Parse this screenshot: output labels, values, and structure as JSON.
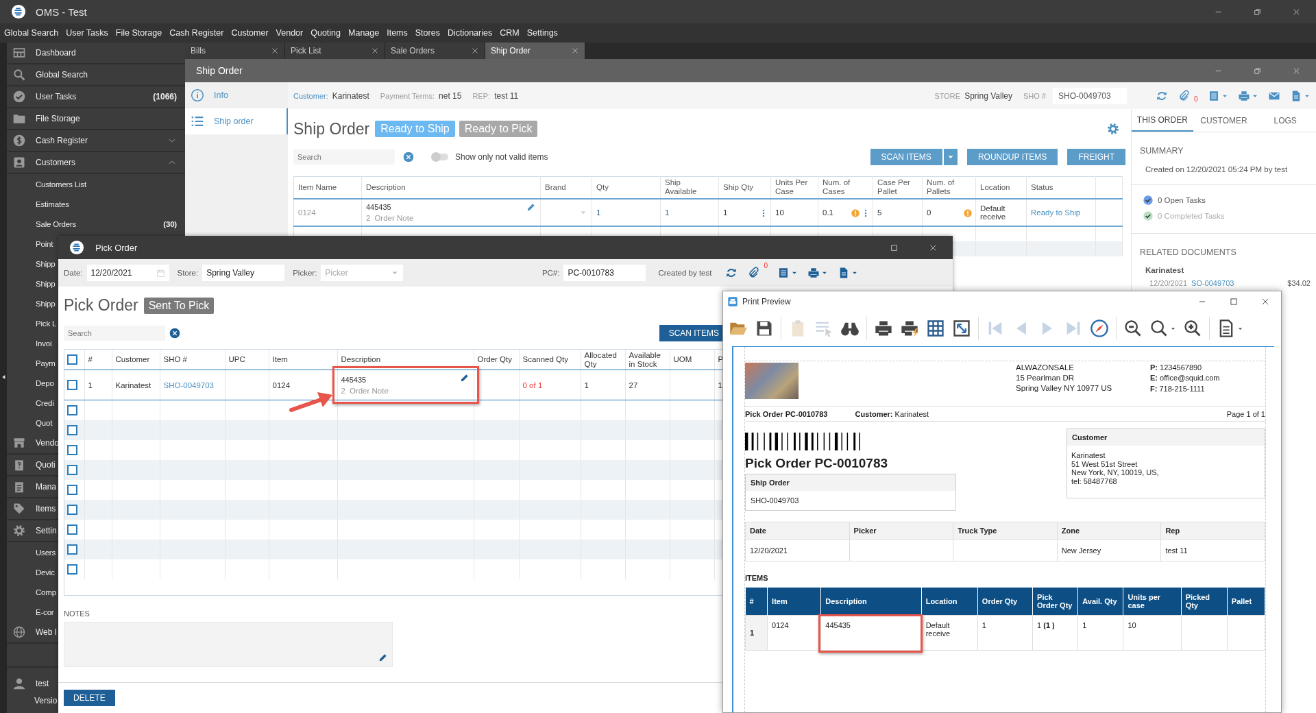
{
  "window": {
    "title": "OMS - Test"
  },
  "menu": [
    "Global Search",
    "User Tasks",
    "File Storage",
    "Cash Register",
    "Customer",
    "Vendor",
    "Quoting",
    "Manage",
    "Items",
    "Stores",
    "Dictionaries",
    "CRM",
    "Settings"
  ],
  "sidebar": {
    "items": [
      {
        "label": "Dashboard"
      },
      {
        "label": "Global Search"
      },
      {
        "label": "User Tasks",
        "count": "(1066)"
      },
      {
        "label": "File Storage"
      },
      {
        "label": "Cash Register",
        "expanded": false
      },
      {
        "label": "Customers",
        "expanded": true,
        "children": [
          {
            "label": "Customers List"
          },
          {
            "label": "Estimates"
          },
          {
            "label": "Sale Orders",
            "count": "(30)"
          },
          {
            "label": "Point"
          },
          {
            "label": "Shipp"
          },
          {
            "label": "Shipp"
          },
          {
            "label": "Shipp"
          },
          {
            "label": "Pick L"
          },
          {
            "label": "Invoi"
          },
          {
            "label": "Paym"
          },
          {
            "label": "Depo"
          },
          {
            "label": "Credi"
          },
          {
            "label": "Quot"
          }
        ]
      },
      {
        "label": "Vendo"
      },
      {
        "label": "Quoti"
      },
      {
        "label": "Mana"
      },
      {
        "label": "Items"
      },
      {
        "label": "Settin",
        "children": [
          {
            "label": "Users"
          },
          {
            "label": "Devic"
          },
          {
            "label": "Comp"
          },
          {
            "label": "E-cor"
          }
        ]
      },
      {
        "label": "Web I"
      }
    ],
    "user": "test",
    "version": "Versio"
  },
  "tabs": [
    {
      "label": "Bills",
      "selected": false
    },
    {
      "label": "Pick List",
      "selected": false
    },
    {
      "label": "Sale Orders",
      "selected": false
    },
    {
      "label": "Ship Order",
      "selected": true
    }
  ],
  "ship_order": {
    "title": "Ship Order",
    "nav": [
      {
        "label": "Info",
        "selected": false
      },
      {
        "label": "Ship order",
        "selected": true
      }
    ],
    "info": [
      {
        "label": "Customer:",
        "value": "Karinatest",
        "kind": "link"
      },
      {
        "label": "Payment Terms:",
        "value": "net 15",
        "kind": "plain"
      },
      {
        "label": "REP:",
        "value": "test 11",
        "kind": "plain"
      }
    ],
    "store_label": "STORE",
    "store": "Spring Valley",
    "sho_label": "SHO #",
    "sho": "SHO-0049703",
    "attachments": "0",
    "heading": "Ship Order",
    "statuses": [
      {
        "label": "Ready to Ship",
        "active": true
      },
      {
        "label": "Ready to Pick",
        "active": false
      }
    ],
    "search": {
      "placeholder": "Search"
    },
    "filter_toggle": {
      "label": "Show only not valid items",
      "on": false
    },
    "buttons": [
      "SCAN ITEMS",
      "ROUNDUP ITEMS",
      "FREIGHT"
    ],
    "table": {
      "columns": [
        "Item Name",
        "Description",
        "Brand",
        "Qty",
        "Ship Available",
        "Ship Qty",
        "Units Per Case",
        "Num. of Cases",
        "Case Per Pallet",
        "Num. of Pallets",
        "Location",
        "Status"
      ],
      "rows": [
        {
          "item_name": "0124",
          "description": "445435",
          "note_count": "2",
          "note": "Order Note",
          "qty": "1",
          "ship_available": "1",
          "ship_qty": "1",
          "units_per_case": "10",
          "num_cases": "0.1",
          "cases_warning": true,
          "case_per_pallet": "5",
          "num_pallets": "0",
          "pallets_warning": true,
          "location": "Default receive",
          "status": "Ready to Ship"
        }
      ]
    }
  },
  "right_panel": {
    "tabs": [
      {
        "label": "THIS ORDER",
        "selected": true
      },
      {
        "label": "CUSTOMER",
        "selected": false
      },
      {
        "label": "LOGS",
        "selected": false
      }
    ],
    "summary_title": "SUMMARY",
    "created": "Created on 12/20/2021 05:24 PM by test",
    "tasks": [
      {
        "label": "0 Open Tasks",
        "active": true
      },
      {
        "label": "0 Completed Tasks",
        "active": false
      }
    ],
    "related_title": "RELATED DOCUMENTS",
    "related": [
      {
        "customer": "Karinatest",
        "date": "12/20/2021",
        "number": "SO-0049703",
        "amount": "$34.02"
      }
    ]
  },
  "pick_order": {
    "title": "Pick Order",
    "date_label": "Date:",
    "date": "12/20/2021",
    "store_label": "Store:",
    "store": "Spring Valley",
    "picker_label": "Picker:",
    "picker_placeholder": "Picker",
    "pc_label": "PC#:",
    "pc": "PC-0010783",
    "created": "Created by test",
    "attachments": "0",
    "heading": "Pick Order",
    "status": "Sent To Pick",
    "search": {
      "placeholder": "Search"
    },
    "scan_button": "SCAN ITEMS",
    "select_all_checked": false,
    "columns": [
      "#",
      "Customer",
      "SHO #",
      "UPC",
      "Item",
      "Description",
      "Order Qty",
      "Scanned Qty",
      "Allocated Qty",
      "Available in Stock",
      "UOM",
      "P"
    ],
    "rows": [
      {
        "checked": false,
        "number": "1",
        "customer": "Karinatest",
        "sho": "SHO-0049703",
        "item": "0124",
        "description": "445435",
        "note_count": "2",
        "note": "Order Note",
        "highlighted": true,
        "scanned": "0 of 1",
        "allocated": "1",
        "available": "27",
        "column_12": "1"
      }
    ],
    "blank_rows": [
      {
        "checked": false
      },
      {
        "checked": false
      },
      {
        "checked": false
      },
      {
        "checked": false
      },
      {
        "checked": false
      },
      {
        "checked": false
      },
      {
        "checked": false
      },
      {
        "checked": false
      },
      {
        "checked": false
      }
    ],
    "notes_label": "NOTES",
    "delete_button": "DELETE"
  },
  "print_preview": {
    "title": "Print Preview",
    "toolbar": [
      {
        "disabled": false
      },
      {
        "disabled": false
      },
      {
        "disabled": true
      },
      {
        "disabled": true
      },
      {
        "disabled": false
      },
      {
        "disabled": false
      },
      {
        "disabled": false
      },
      {
        "disabled": false
      },
      {
        "disabled": false
      },
      {
        "disabled": true
      },
      {
        "disabled": true
      },
      {
        "disabled": true
      },
      {
        "disabled": true
      },
      {
        "disabled": false
      },
      {
        "disabled": false
      },
      {
        "disabled": false
      },
      {
        "disabled": false
      },
      {
        "disabled": false
      }
    ],
    "company": [
      "ALWAZONSALE",
      "15 Pearlman DR",
      "Spring Valley NY 10977 US"
    ],
    "contacts": [
      "**P:** 1234567890",
      "**E:** office@squid.com",
      "**F:** 718-215-1111"
    ],
    "header_title": "Pick Order PC-0010783",
    "header_customer": "**Customer:** Karinatest",
    "page": "Page 1 of 1",
    "doc_title": "Pick Order PC-0010783",
    "ship_order_label": "Ship Order",
    "ship_order": "SHO-0049703",
    "customer_label": "Customer",
    "customer_lines": [
      "Karinatest",
      "51 West 51st Street",
      "New York, NY, 10019, US,",
      "tel: 58487768"
    ],
    "info": [
      {
        "label": "Date",
        "value": "12/20/2021"
      },
      {
        "label": "Picker"
      },
      {
        "label": "Truck Type"
      },
      {
        "label": "Zone",
        "value": "New Jersey"
      },
      {
        "label": "Rep",
        "value": "test 11"
      }
    ],
    "items_title": "ITEMS",
    "items_columns": [
      "#",
      "Item",
      "Description",
      "Location",
      "Order Qty",
      "Pick Order Qty",
      "Avail. Qty",
      "Units per case",
      "Picked Qty",
      "Pallet"
    ],
    "items_rows": [
      {
        "number": "1",
        "item": "0124",
        "description": "445435",
        "highlighted": true,
        "location": "Default receive",
        "order_qty": "1",
        "pick_order_qty": "1 **(1 )**",
        "avail_qty": "1",
        "units_per_case": "10"
      }
    ]
  }
}
